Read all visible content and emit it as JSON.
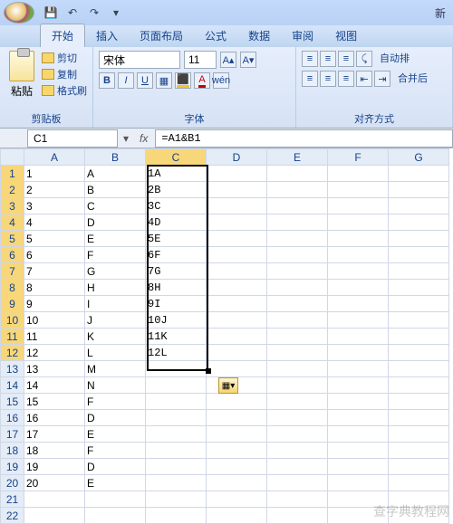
{
  "title_suffix": "新",
  "tabs": [
    "开始",
    "插入",
    "页面布局",
    "公式",
    "数据",
    "审阅",
    "视图"
  ],
  "active_tab": 0,
  "ribbon": {
    "clipboard": {
      "paste": "粘贴",
      "cut": "剪切",
      "copy": "复制",
      "format_painter": "格式刷",
      "label": "剪贴板"
    },
    "font": {
      "name": "宋体",
      "size": "11",
      "label": "字体"
    },
    "alignment": {
      "label": "对齐方式",
      "autofit": "自动排",
      "merge": "合并后"
    }
  },
  "namebox": "C1",
  "formula": "=A1&B1",
  "columns": [
    "A",
    "B",
    "C",
    "D",
    "E",
    "F",
    "G"
  ],
  "rows": [
    {
      "n": 1,
      "a": "1",
      "b": "A",
      "c": "1A"
    },
    {
      "n": 2,
      "a": "2",
      "b": "B",
      "c": "2B"
    },
    {
      "n": 3,
      "a": "3",
      "b": "C",
      "c": "3C"
    },
    {
      "n": 4,
      "a": "4",
      "b": "D",
      "c": "4D"
    },
    {
      "n": 5,
      "a": "5",
      "b": "E",
      "c": "5E"
    },
    {
      "n": 6,
      "a": "6",
      "b": "F",
      "c": "6F"
    },
    {
      "n": 7,
      "a": "7",
      "b": "G",
      "c": "7G"
    },
    {
      "n": 8,
      "a": "8",
      "b": "H",
      "c": "8H"
    },
    {
      "n": 9,
      "a": "9",
      "b": "I",
      "c": "9I"
    },
    {
      "n": 10,
      "a": "10",
      "b": "J",
      "c": "10J"
    },
    {
      "n": 11,
      "a": "11",
      "b": "K",
      "c": "11K"
    },
    {
      "n": 12,
      "a": "12",
      "b": "L",
      "c": "12L"
    },
    {
      "n": 13,
      "a": "13",
      "b": "M",
      "c": ""
    },
    {
      "n": 14,
      "a": "14",
      "b": "N",
      "c": ""
    },
    {
      "n": 15,
      "a": "15",
      "b": "F",
      "c": ""
    },
    {
      "n": 16,
      "a": "16",
      "b": "D",
      "c": ""
    },
    {
      "n": 17,
      "a": "17",
      "b": "E",
      "c": ""
    },
    {
      "n": 18,
      "a": "18",
      "b": "F",
      "c": ""
    },
    {
      "n": 19,
      "a": "19",
      "b": "D",
      "c": ""
    },
    {
      "n": 20,
      "a": "20",
      "b": "E",
      "c": ""
    },
    {
      "n": 21,
      "a": "",
      "b": "",
      "c": ""
    },
    {
      "n": 22,
      "a": "",
      "b": "",
      "c": ""
    }
  ],
  "selection": {
    "col": "C",
    "from_row": 1,
    "to_row": 12
  },
  "watermark": "查字典教程网"
}
